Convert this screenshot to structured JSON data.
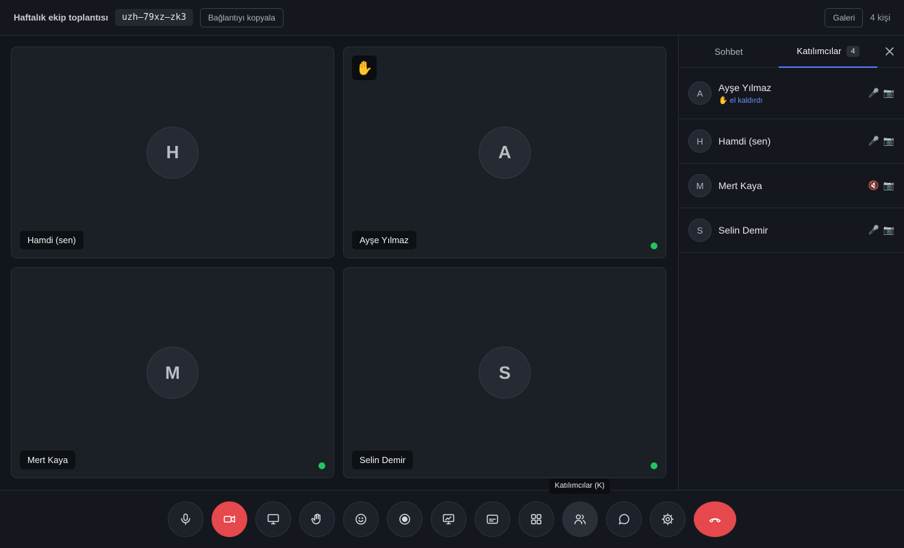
{
  "header": {
    "meeting_title": "Haftalık ekip toplantısı",
    "meeting_code": "uzh–79xz–zk3",
    "copy_link_label": "Bağlantıyı kopyala",
    "layout_label": "Galeri",
    "people_count": "4 kişi"
  },
  "tiles": [
    {
      "name": "Hamdi (sen)",
      "initial": "H"
    },
    {
      "name": "Ayşe Yılmaz",
      "initial": "A",
      "hand": "✋"
    },
    {
      "name": "Mert Kaya",
      "initial": "M"
    },
    {
      "name": "Selin Demir",
      "initial": "S"
    }
  ],
  "panel": {
    "tab_chat": "Sohbet",
    "tab_people": "Katılımcılar",
    "people_badge": "4",
    "participants": [
      {
        "initial": "A",
        "name": "Ayşe Yılmaz",
        "status": "✋ el kaldırdı",
        "mic": "🎤",
        "cam": "📷"
      },
      {
        "initial": "H",
        "name": "Hamdi (sen)",
        "mic": "🎤",
        "cam": "📷"
      },
      {
        "initial": "M",
        "name": "Mert Kaya",
        "mic": "🔇",
        "cam": "📷"
      },
      {
        "initial": "S",
        "name": "Selin Demir",
        "mic": "🎤",
        "cam": "📷"
      }
    ]
  },
  "toolbar": {
    "tooltip": "Katılımcılar (K)"
  },
  "colors": {
    "accent": "#5b7cfa",
    "danger": "#e5484d",
    "online": "#22c55e",
    "background": "#12161c"
  },
  "icons": [
    "mic-icon",
    "camera-off-icon",
    "screen-share-icon",
    "raise-hand-icon",
    "emoji-icon",
    "record-icon",
    "whiteboard-icon",
    "captions-icon",
    "layout-grid-icon",
    "participants-icon",
    "chat-icon",
    "settings-icon",
    "leave-call-icon",
    "close-icon"
  ]
}
